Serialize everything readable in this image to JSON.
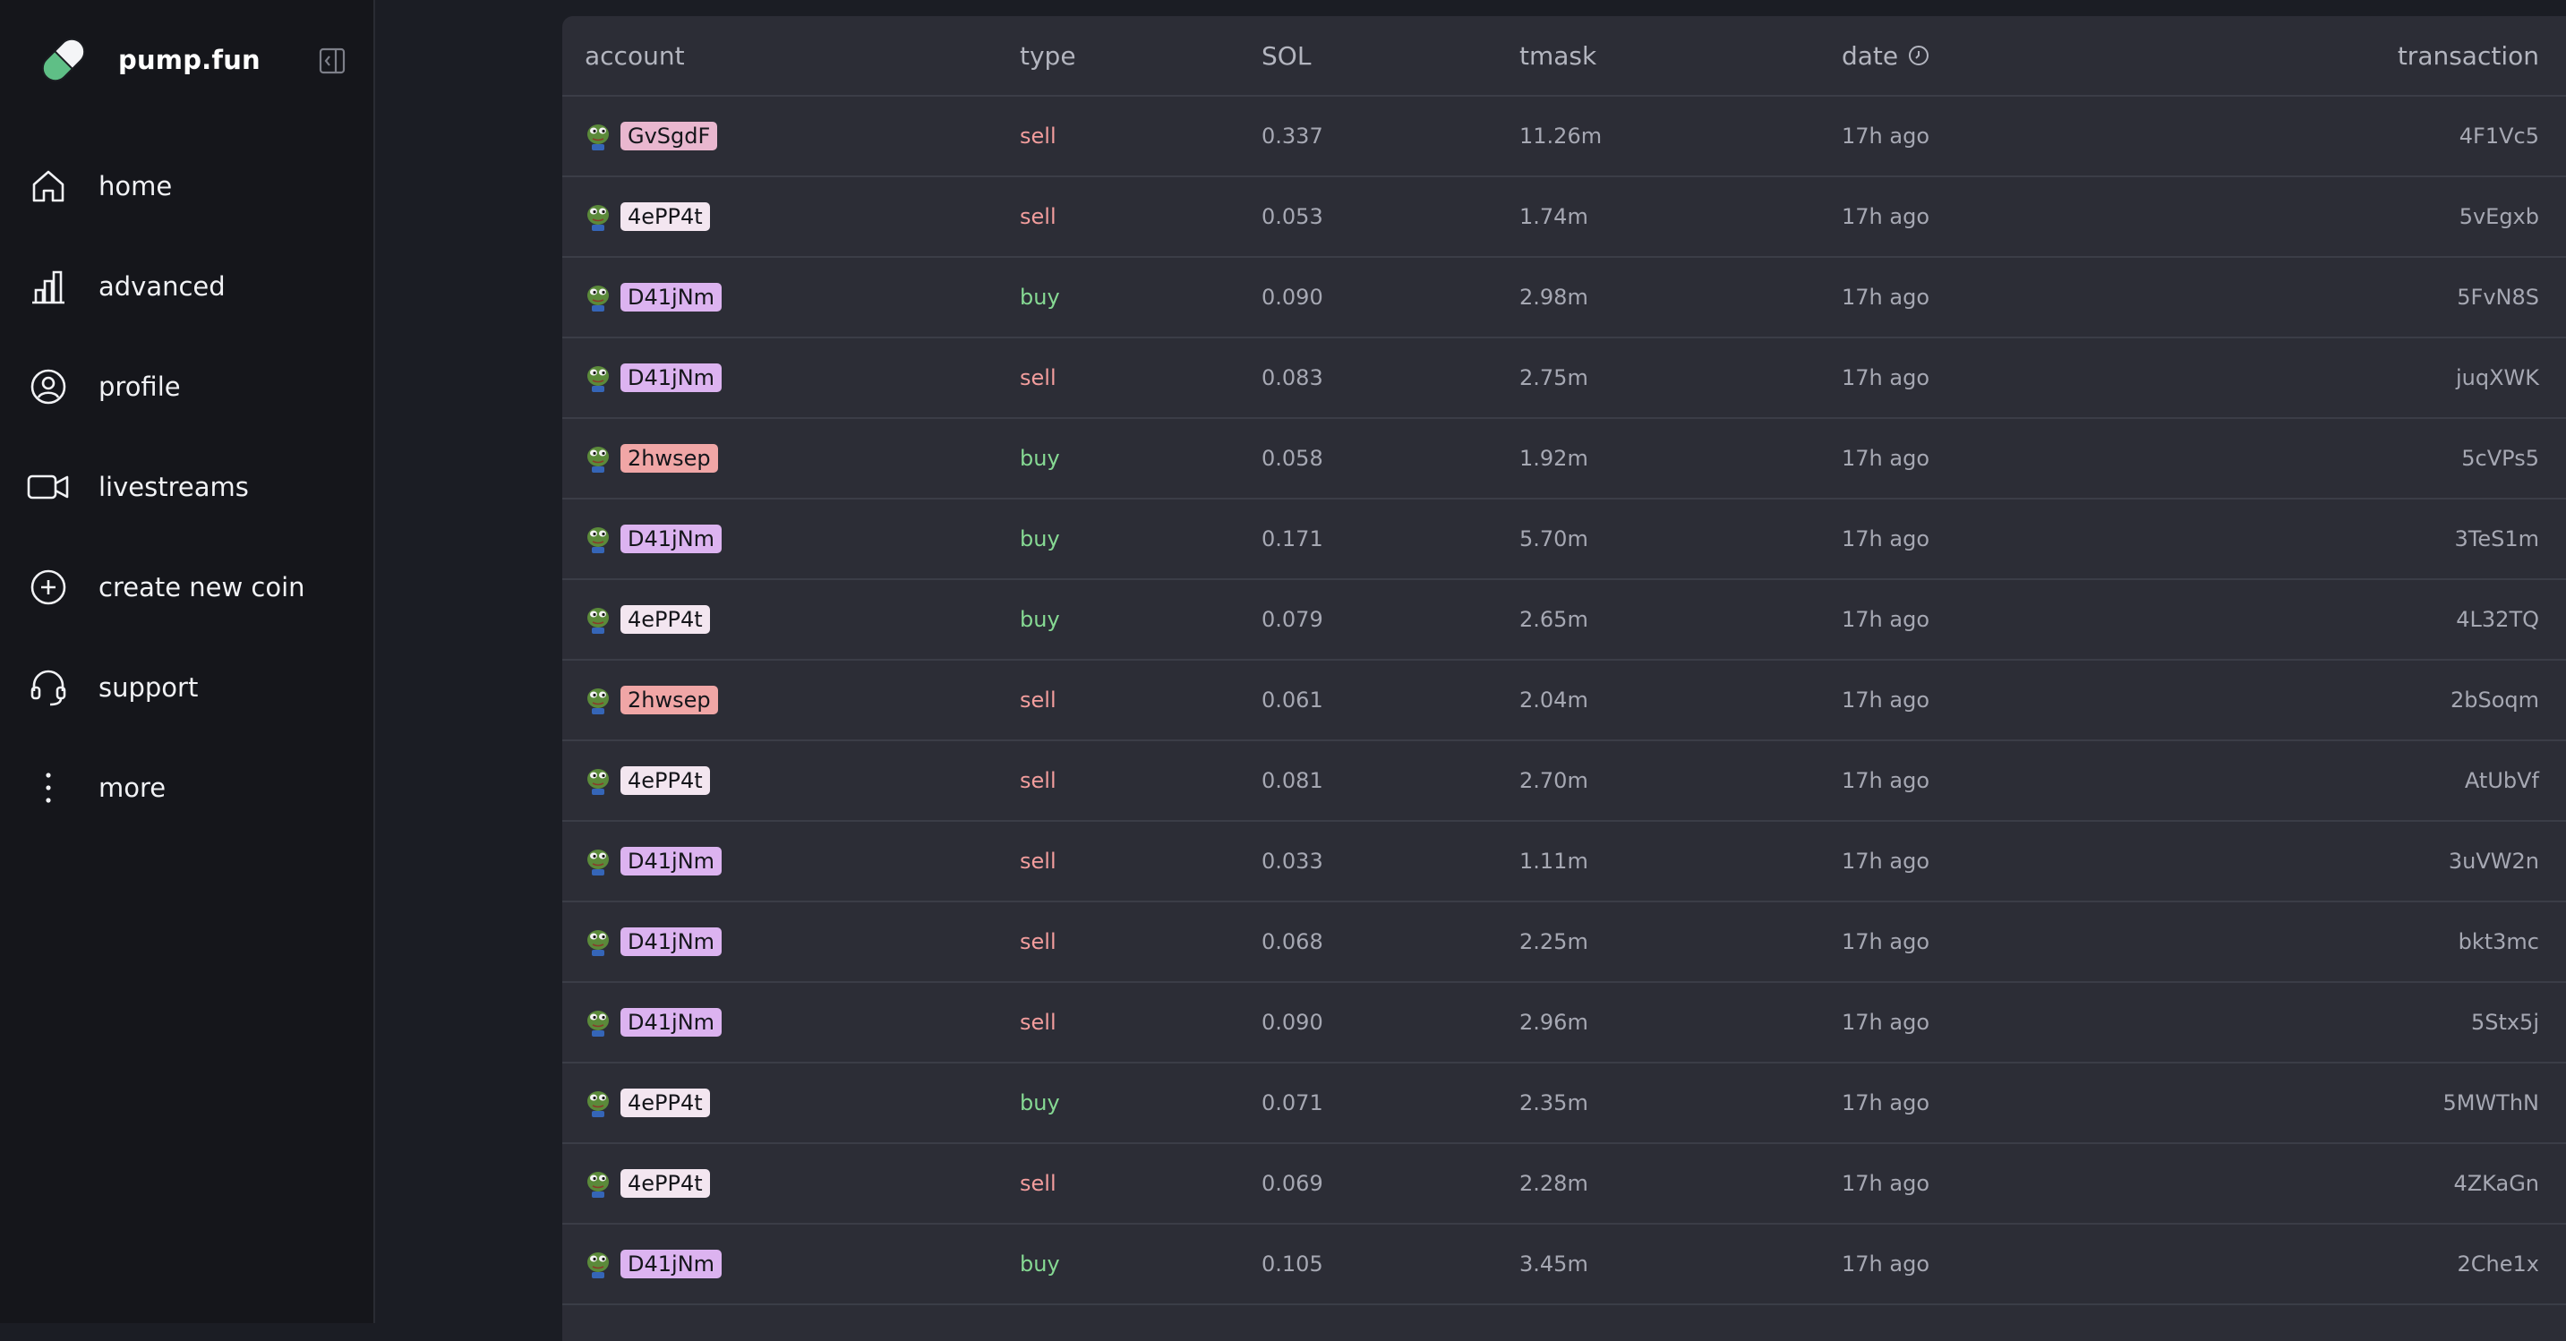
{
  "app": {
    "name": "pump.fun"
  },
  "colors": {
    "sidebar_bg": "#15161b",
    "panel_bg": "#2c2d36",
    "sell": "#f29d9d",
    "buy": "#86d993",
    "tag_pink": "#e9b7cf",
    "tag_lavender": "#dcb3f0",
    "tag_light": "#f3e6f0",
    "tag_salmon": "#f0a6a6"
  },
  "sidebar": {
    "items": [
      {
        "label": "home",
        "icon": "home-icon"
      },
      {
        "label": "advanced",
        "icon": "bar-chart-icon"
      },
      {
        "label": "profile",
        "icon": "user-circle-icon"
      },
      {
        "label": "livestreams",
        "icon": "video-camera-icon"
      },
      {
        "label": "create new coin",
        "icon": "plus-circle-icon"
      },
      {
        "label": "support",
        "icon": "headset-icon"
      },
      {
        "label": "more",
        "icon": "more-vertical-icon"
      }
    ]
  },
  "table": {
    "headers": {
      "account": "account",
      "type": "type",
      "sol": "SOL",
      "token": "tmask",
      "date": "date",
      "transaction": "transaction"
    },
    "rows": [
      {
        "account": "GvSgdF",
        "tag_color": "#e9b7cf",
        "type": "sell",
        "sol": "0.337",
        "token": "11.26m",
        "date": "17h ago",
        "tx": "4F1Vc5"
      },
      {
        "account": "4ePP4t",
        "tag_color": "#f3e6f0",
        "type": "sell",
        "sol": "0.053",
        "token": "1.74m",
        "date": "17h ago",
        "tx": "5vEgxb"
      },
      {
        "account": "D41jNm",
        "tag_color": "#dcb3f0",
        "type": "buy",
        "sol": "0.090",
        "token": "2.98m",
        "date": "17h ago",
        "tx": "5FvN8S"
      },
      {
        "account": "D41jNm",
        "tag_color": "#dcb3f0",
        "type": "sell",
        "sol": "0.083",
        "token": "2.75m",
        "date": "17h ago",
        "tx": "juqXWK"
      },
      {
        "account": "2hwsep",
        "tag_color": "#f0a6a6",
        "type": "buy",
        "sol": "0.058",
        "token": "1.92m",
        "date": "17h ago",
        "tx": "5cVPs5"
      },
      {
        "account": "D41jNm",
        "tag_color": "#dcb3f0",
        "type": "buy",
        "sol": "0.171",
        "token": "5.70m",
        "date": "17h ago",
        "tx": "3TeS1m"
      },
      {
        "account": "4ePP4t",
        "tag_color": "#f3e6f0",
        "type": "buy",
        "sol": "0.079",
        "token": "2.65m",
        "date": "17h ago",
        "tx": "4L32TQ"
      },
      {
        "account": "2hwsep",
        "tag_color": "#f0a6a6",
        "type": "sell",
        "sol": "0.061",
        "token": "2.04m",
        "date": "17h ago",
        "tx": "2bSoqm"
      },
      {
        "account": "4ePP4t",
        "tag_color": "#f3e6f0",
        "type": "sell",
        "sol": "0.081",
        "token": "2.70m",
        "date": "17h ago",
        "tx": "AtUbVf"
      },
      {
        "account": "D41jNm",
        "tag_color": "#dcb3f0",
        "type": "sell",
        "sol": "0.033",
        "token": "1.11m",
        "date": "17h ago",
        "tx": "3uVW2n"
      },
      {
        "account": "D41jNm",
        "tag_color": "#dcb3f0",
        "type": "sell",
        "sol": "0.068",
        "token": "2.25m",
        "date": "17h ago",
        "tx": "bkt3mc"
      },
      {
        "account": "D41jNm",
        "tag_color": "#dcb3f0",
        "type": "sell",
        "sol": "0.090",
        "token": "2.96m",
        "date": "17h ago",
        "tx": "5Stx5j"
      },
      {
        "account": "4ePP4t",
        "tag_color": "#f3e6f0",
        "type": "buy",
        "sol": "0.071",
        "token": "2.35m",
        "date": "17h ago",
        "tx": "5MWThN"
      },
      {
        "account": "4ePP4t",
        "tag_color": "#f3e6f0",
        "type": "sell",
        "sol": "0.069",
        "token": "2.28m",
        "date": "17h ago",
        "tx": "4ZKaGn"
      },
      {
        "account": "D41jNm",
        "tag_color": "#dcb3f0",
        "type": "buy",
        "sol": "0.105",
        "token": "3.45m",
        "date": "17h ago",
        "tx": "2Che1x"
      }
    ]
  }
}
